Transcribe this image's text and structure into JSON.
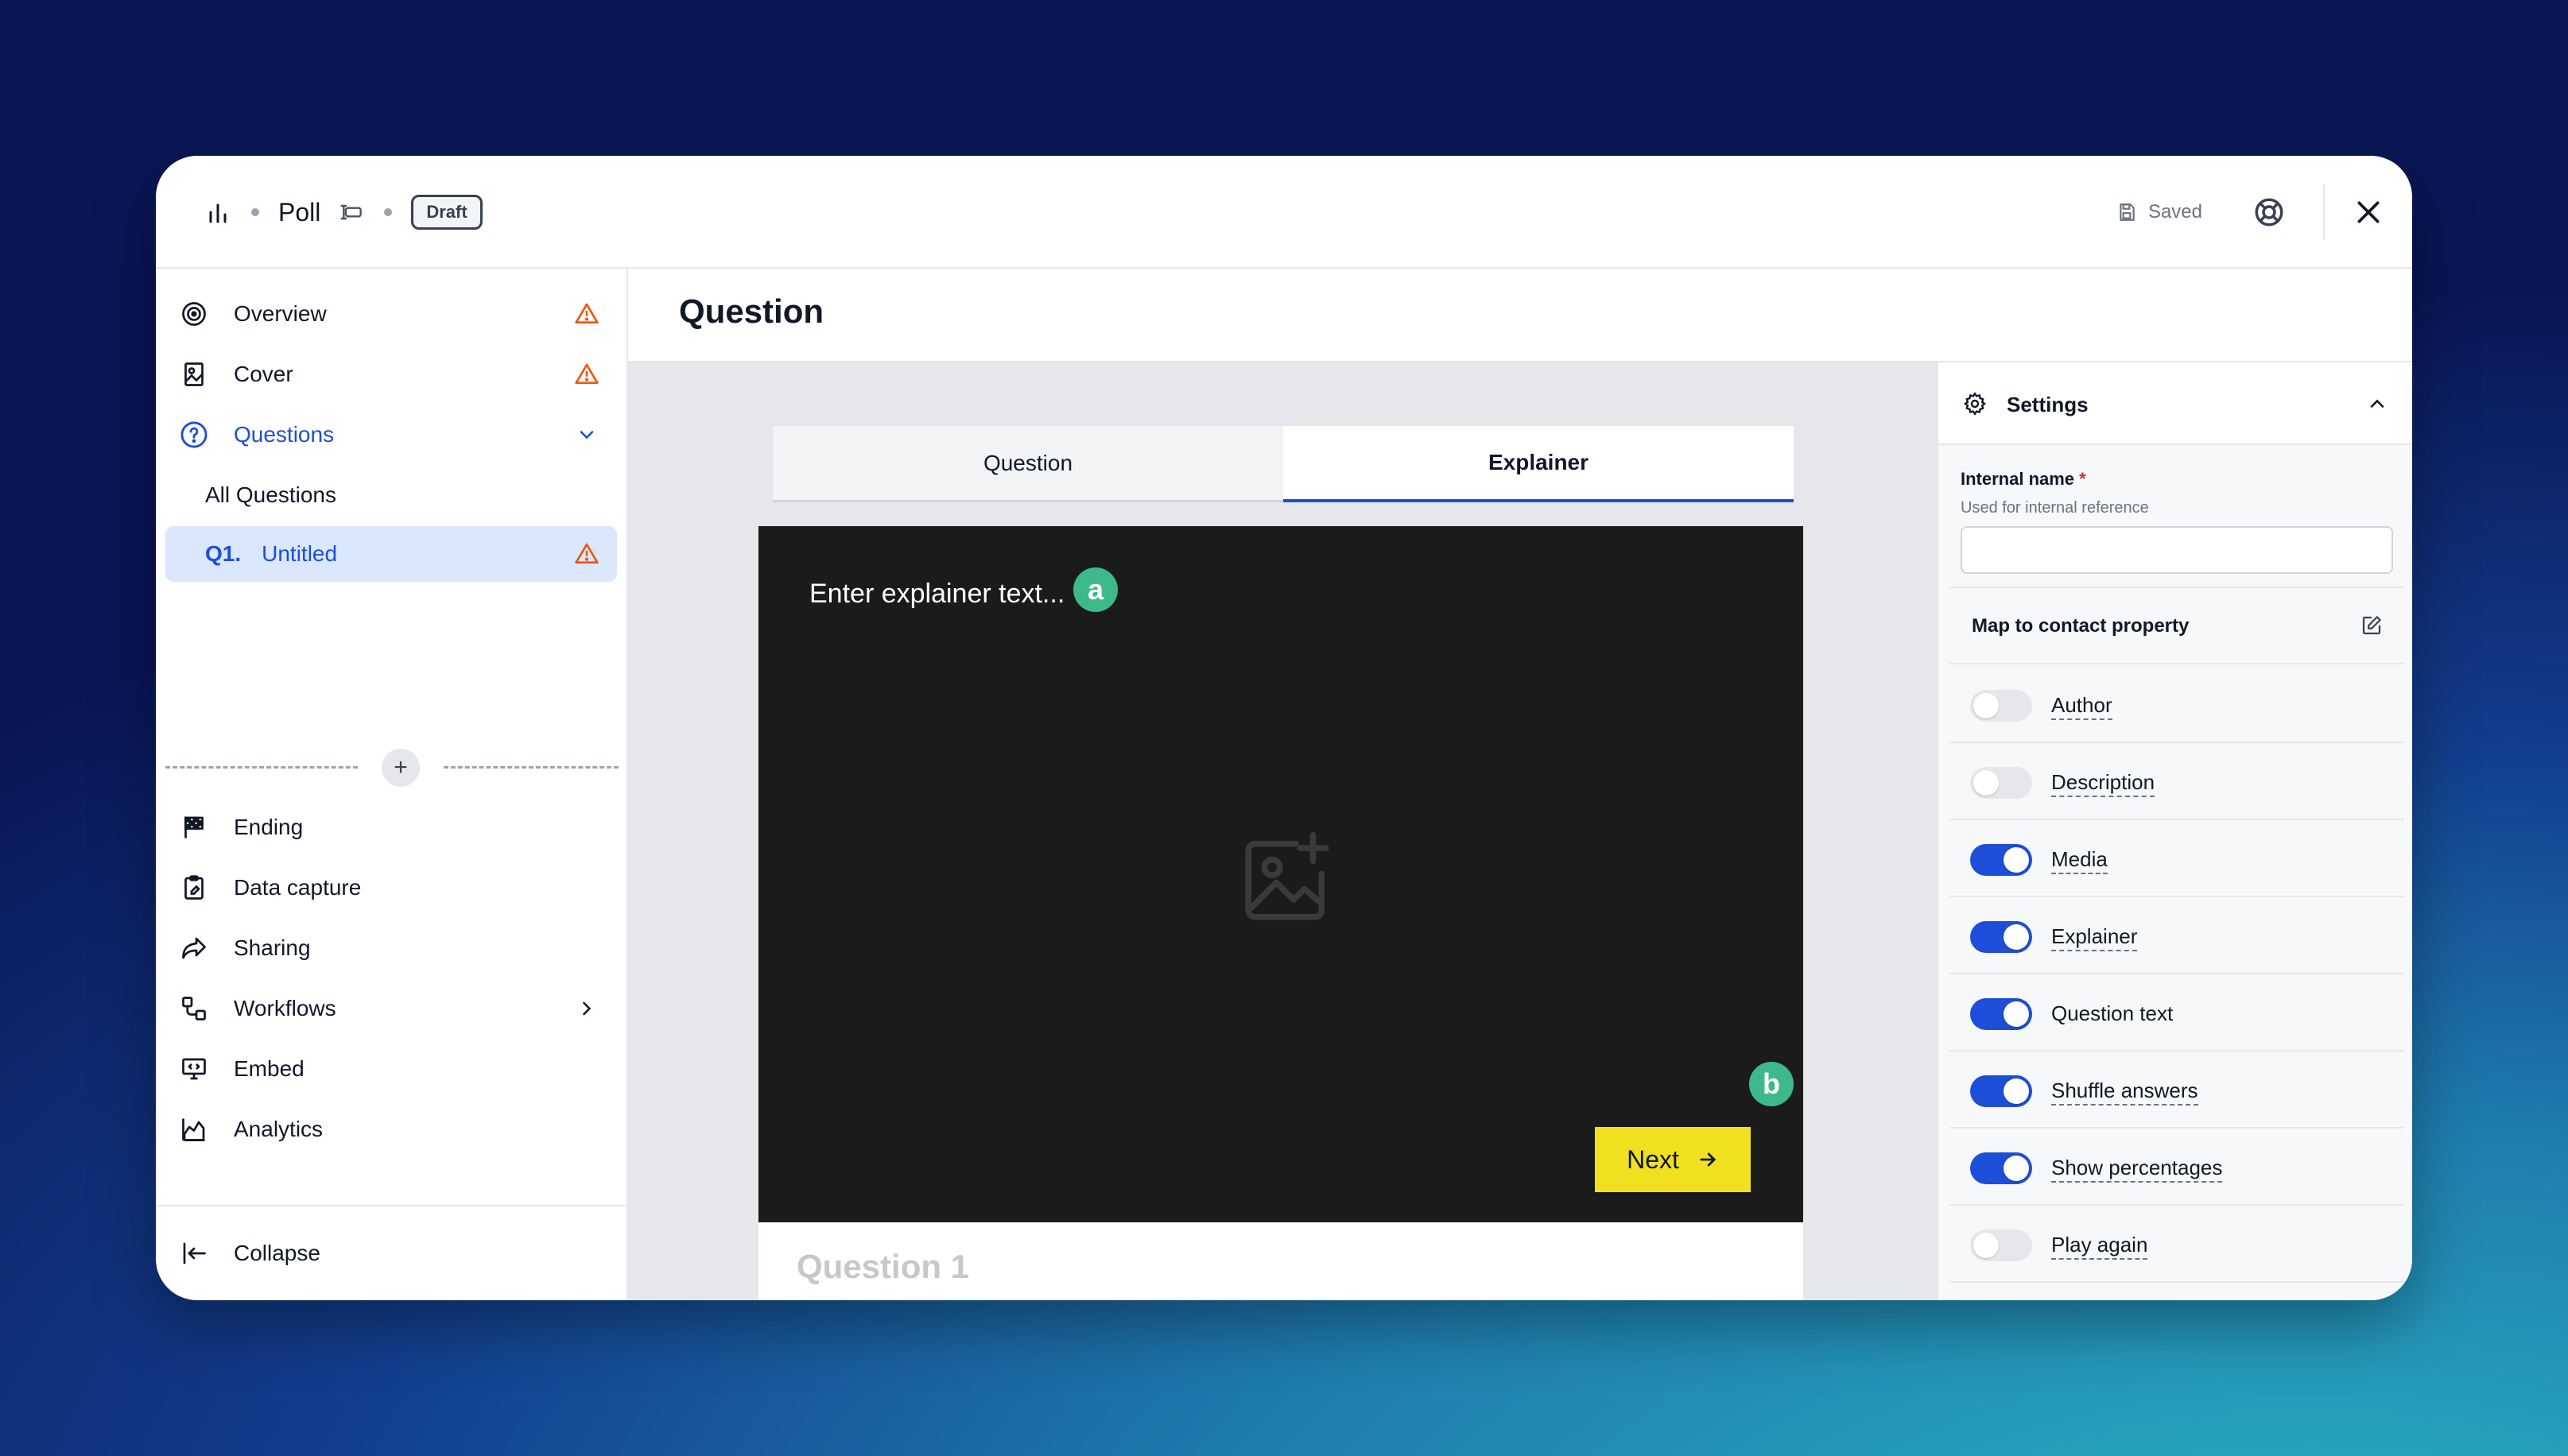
{
  "header": {
    "app_title": "Poll",
    "status_badge": "Draft",
    "saved_label": "Saved"
  },
  "sidebar": {
    "items": [
      {
        "label": "Overview",
        "icon": "target-icon",
        "warning": true
      },
      {
        "label": "Cover",
        "icon": "image-portrait-icon",
        "warning": true
      },
      {
        "label": "Questions",
        "icon": "question-circle-icon",
        "expanded": true
      }
    ],
    "sub_items": {
      "all_questions": "All Questions",
      "selected_number": "Q1.",
      "selected_label": "Untitled"
    },
    "more_items": [
      {
        "label": "Ending",
        "icon": "checkered-flag-icon"
      },
      {
        "label": "Data capture",
        "icon": "clipboard-icon"
      },
      {
        "label": "Sharing",
        "icon": "share-arrow-icon"
      },
      {
        "label": "Workflows",
        "icon": "workflow-icon"
      },
      {
        "label": "Embed",
        "icon": "embed-monitor-icon"
      },
      {
        "label": "Analytics",
        "icon": "analytics-chart-icon"
      }
    ],
    "collapse_label": "Collapse"
  },
  "main": {
    "page_title": "Question",
    "tabs": [
      "Question",
      "Explainer"
    ],
    "active_tab": "Explainer",
    "preview": {
      "placeholder_text": "Enter explainer text...",
      "badge_a": "a",
      "badge_b": "b",
      "next_label": "Next",
      "question_heading": "Question 1",
      "next_color": "#f0e020"
    }
  },
  "settings": {
    "title": "Settings",
    "internal_name_label": "Internal name",
    "required_mark": "*",
    "internal_name_hint": "Used for internal reference",
    "internal_name_value": "",
    "map_label": "Map to contact property",
    "toggles": [
      {
        "label": "Author",
        "on": false
      },
      {
        "label": "Description",
        "on": false
      },
      {
        "label": "Media",
        "on": true
      },
      {
        "label": "Explainer",
        "on": true
      },
      {
        "label": "Question text",
        "on": true
      },
      {
        "label": "Shuffle answers",
        "on": true
      },
      {
        "label": "Show percentages",
        "on": true
      },
      {
        "label": "Play again",
        "on": false
      }
    ]
  },
  "colors": {
    "accent": "#1d4ed8",
    "warning": "#ea580c",
    "badge_green": "#3dba8c"
  }
}
